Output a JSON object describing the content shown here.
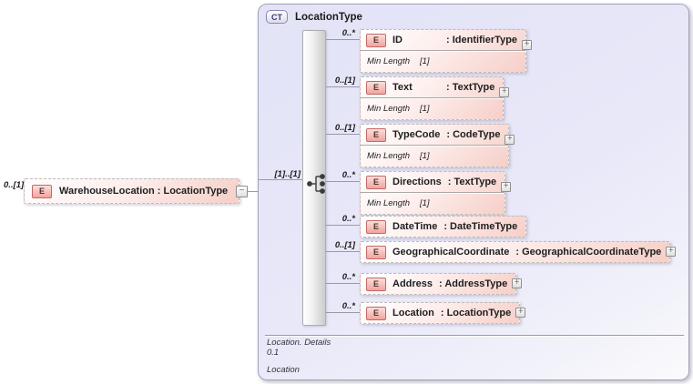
{
  "root": {
    "cardinality": "0..[1]",
    "badge": "E",
    "label": "WarehouseLocation : LocationType",
    "collapse_glyph": "−"
  },
  "panel": {
    "badge": "CT",
    "title": "LocationType",
    "compositor": {
      "kind": "sequence",
      "cardinality": "[1]..[1]"
    },
    "children": [
      {
        "cardinality": "0..*",
        "badge": "E",
        "name": "ID",
        "type": ": IdentifierType",
        "facet_name": "Min Length",
        "facet_value": "[1]",
        "expander": "+"
      },
      {
        "cardinality": "0..[1]",
        "badge": "E",
        "name": "Text",
        "type": ": TextType",
        "facet_name": "Min Length",
        "facet_value": "[1]",
        "expander": "+"
      },
      {
        "cardinality": "0..[1]",
        "badge": "E",
        "name": "TypeCode",
        "type": ": CodeType",
        "facet_name": "Min Length",
        "facet_value": "[1]",
        "expander": "+"
      },
      {
        "cardinality": "0..*",
        "badge": "E",
        "name": "Directions",
        "type": ": TextType",
        "facet_name": "Min Length",
        "facet_value": "[1]",
        "expander": "+"
      },
      {
        "cardinality": "0..*",
        "badge": "E",
        "name": "DateTime",
        "type": ": DateTimeType"
      },
      {
        "cardinality": "0..[1]",
        "badge": "E",
        "name": "GeographicalCoordinate",
        "type": ": GeographicalCoordinateType",
        "expander": "+"
      },
      {
        "cardinality": "0..*",
        "badge": "E",
        "name": "Address",
        "type": ": AddressType",
        "expander": "+"
      },
      {
        "cardinality": "0..*",
        "badge": "E",
        "name": "Location",
        "type": ": LocationType",
        "expander": "+"
      }
    ],
    "footer": {
      "details": "Location. Details",
      "range": "0.1",
      "name": "Location"
    }
  },
  "colors": {
    "element_fill": "#f6cfc8",
    "element_badge": "#f1a49e",
    "panel_fill": "#e6e6f8",
    "connector": "#999aa6"
  }
}
